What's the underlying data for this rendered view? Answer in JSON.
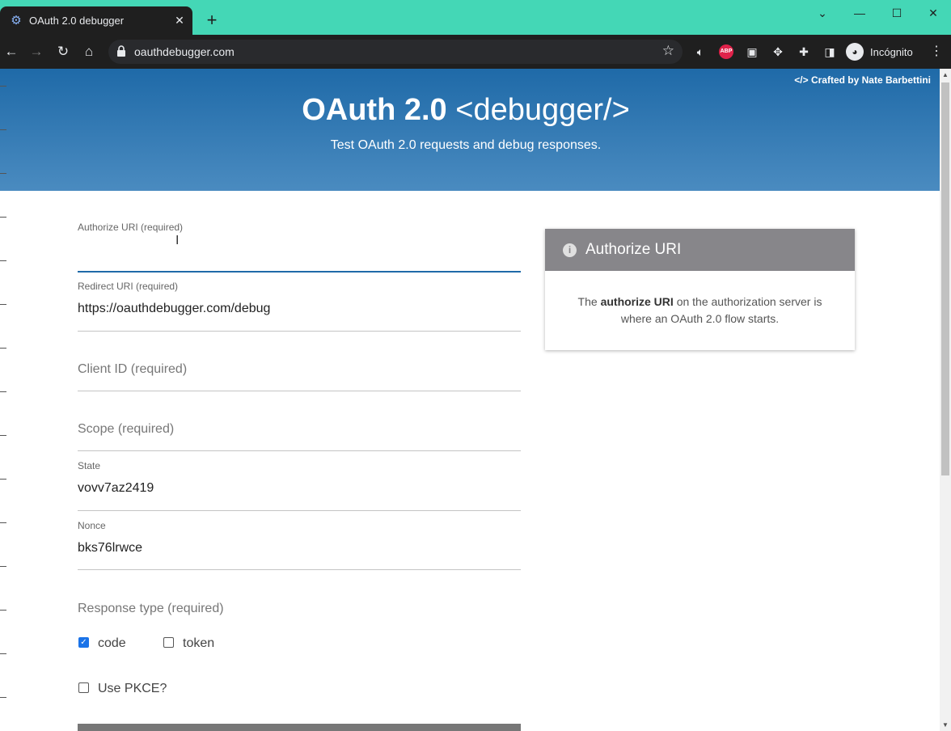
{
  "browser": {
    "tab_title": "OAuth 2.0 debugger",
    "url": "oauthdebugger.com",
    "profile_label": "Incógnito"
  },
  "header": {
    "credit": "</> Crafted by Nate Barbettini",
    "title_brand": "OAuth 2.0",
    "title_tag": "<debugger/>",
    "subtitle": "Test OAuth 2.0 requests and debug responses."
  },
  "form": {
    "authorize_uri": {
      "label": "Authorize URI (required)",
      "value": ""
    },
    "redirect_uri": {
      "label": "Redirect URI (required)",
      "value": "https://oauthdebugger.com/debug"
    },
    "client_id": {
      "label": "Client ID (required)",
      "value": ""
    },
    "scope": {
      "label": "Scope (required)",
      "value": ""
    },
    "state": {
      "label": "State",
      "value": "vovv7az2419"
    },
    "nonce": {
      "label": "Nonce",
      "value": "bks76lrwce"
    },
    "response_type_label": "Response type (required)",
    "response_code": {
      "label": "code",
      "checked": true
    },
    "response_token": {
      "label": "token",
      "checked": false
    },
    "use_pkce": {
      "label": "Use PKCE?",
      "checked": false
    }
  },
  "info_card": {
    "title": "Authorize URI",
    "text_prefix": "The",
    "text_bold": "authorize URI",
    "text_suffix": "on the authorization server is where an OAuth 2.0 flow starts."
  },
  "colors": {
    "titlebar": "#44d7b6",
    "hero_top": "#1f6aa8",
    "hero_bottom": "#4a8bc0",
    "card_header": "#87868a",
    "focus": "#1f6aa8"
  }
}
